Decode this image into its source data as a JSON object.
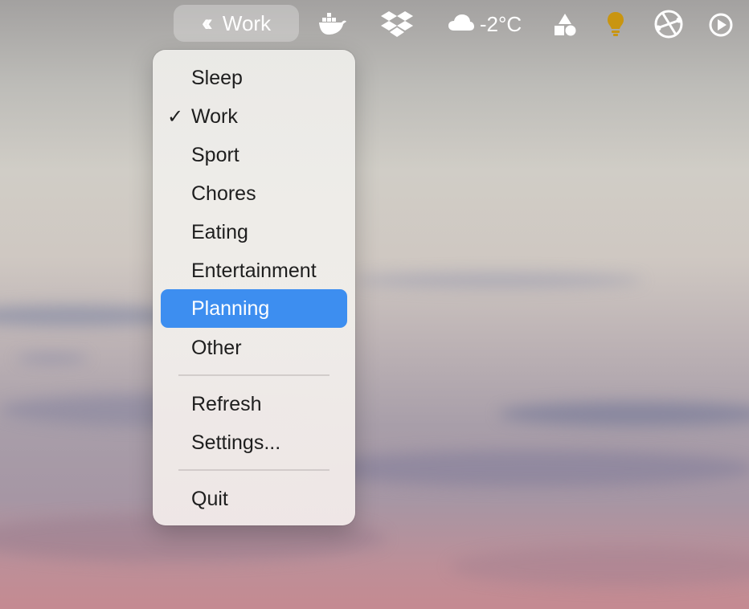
{
  "menubar": {
    "status_pill": {
      "chevron_icon": "double-chevron-left-icon",
      "label": "Work"
    },
    "icons": [
      "docker-icon",
      "dropbox-icon",
      "shapes-icon",
      "lightbulb-icon",
      "vpn-globe-icon",
      "play-circle-icon"
    ],
    "weather": {
      "icon": "cloud-icon",
      "temperature": "-2°C"
    }
  },
  "menu": {
    "items": [
      {
        "label": "Sleep",
        "checked": false
      },
      {
        "label": "Work",
        "checked": true,
        "check_mark": "✓"
      },
      {
        "label": "Sport",
        "checked": false
      },
      {
        "label": "Chores",
        "checked": false
      },
      {
        "label": "Eating",
        "checked": false
      },
      {
        "label": "Entertainment",
        "checked": false
      },
      {
        "label": "Planning",
        "checked": false,
        "highlighted": true
      },
      {
        "label": "Other",
        "checked": false
      }
    ],
    "actions": [
      {
        "label": "Refresh"
      },
      {
        "label": "Settings..."
      }
    ],
    "quit": {
      "label": "Quit"
    }
  },
  "colors": {
    "highlight": "#3d8ef0",
    "lightbulb": "#c99510",
    "menu_text": "#1e1e1e"
  }
}
